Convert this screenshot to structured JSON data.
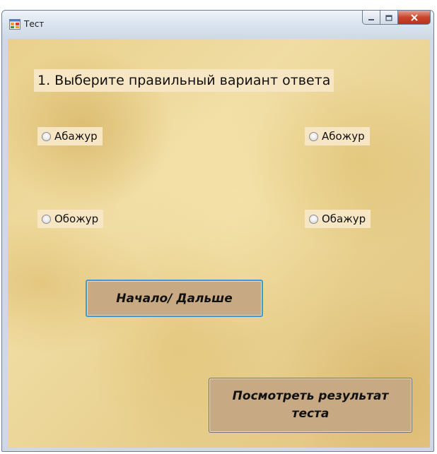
{
  "window": {
    "title": "Тест",
    "icon": "app-window-icon",
    "caption_buttons": [
      "minimize-icon",
      "maximize-icon",
      "close-icon"
    ]
  },
  "question": {
    "text": "1. Выберите правильный вариант ответа"
  },
  "options": [
    {
      "label": "Абажур",
      "selected": false
    },
    {
      "label": "Абожур",
      "selected": false
    },
    {
      "label": "Обожур",
      "selected": false
    },
    {
      "label": "Обажур",
      "selected": false
    }
  ],
  "buttons": {
    "next_label": "Начало/ Дальше",
    "results_label": "Посмотреть результат теста"
  },
  "colors": {
    "label_background": "#f7e6c4",
    "button_background": "#c7a983",
    "focus_border": "#3b9bd3",
    "close_button": "#c9452b"
  }
}
